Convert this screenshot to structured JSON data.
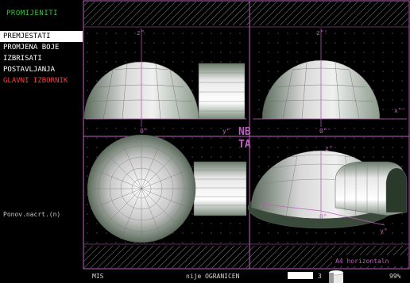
{
  "sidebar": {
    "title": "PROMIJENITI",
    "items": [
      {
        "label": "PREMJESTATI",
        "selected": true,
        "color": "#000000"
      },
      {
        "label": "PROMJENA BOJE",
        "selected": false,
        "color": "#ffffff"
      },
      {
        "label": "IZBRISATI",
        "selected": false,
        "color": "#ffffff"
      },
      {
        "label": "POSTAVLJANJA",
        "selected": false,
        "color": "#ffffff"
      },
      {
        "label": "GLAVNI IZBORNIK",
        "selected": false,
        "color": "#ff3b3b"
      }
    ],
    "redraw_label": "Ponov.nacrt.(n)"
  },
  "viewport": {
    "view_code_top": "NB",
    "view_code_bottom": "TA",
    "axes": {
      "front": {
        "z": "z\"",
        "x": "0\"",
        "y": "y\""
      },
      "side": {
        "z": "z\"'",
        "x": "0\"'",
        "y": "x\"'"
      },
      "iso": {
        "z": "z°",
        "x": "x°",
        "y": "y°",
        "o": "O°"
      }
    },
    "paper_format": "A4 horizontaln"
  },
  "status": {
    "mode": "MIS",
    "constraint": "nije OGRANICEN",
    "layer_number": "3",
    "zoom": "99%"
  },
  "colors": {
    "accent_green": "#39c339",
    "frame_magenta": "#c060c0",
    "menu_red": "#ff3b3b"
  }
}
